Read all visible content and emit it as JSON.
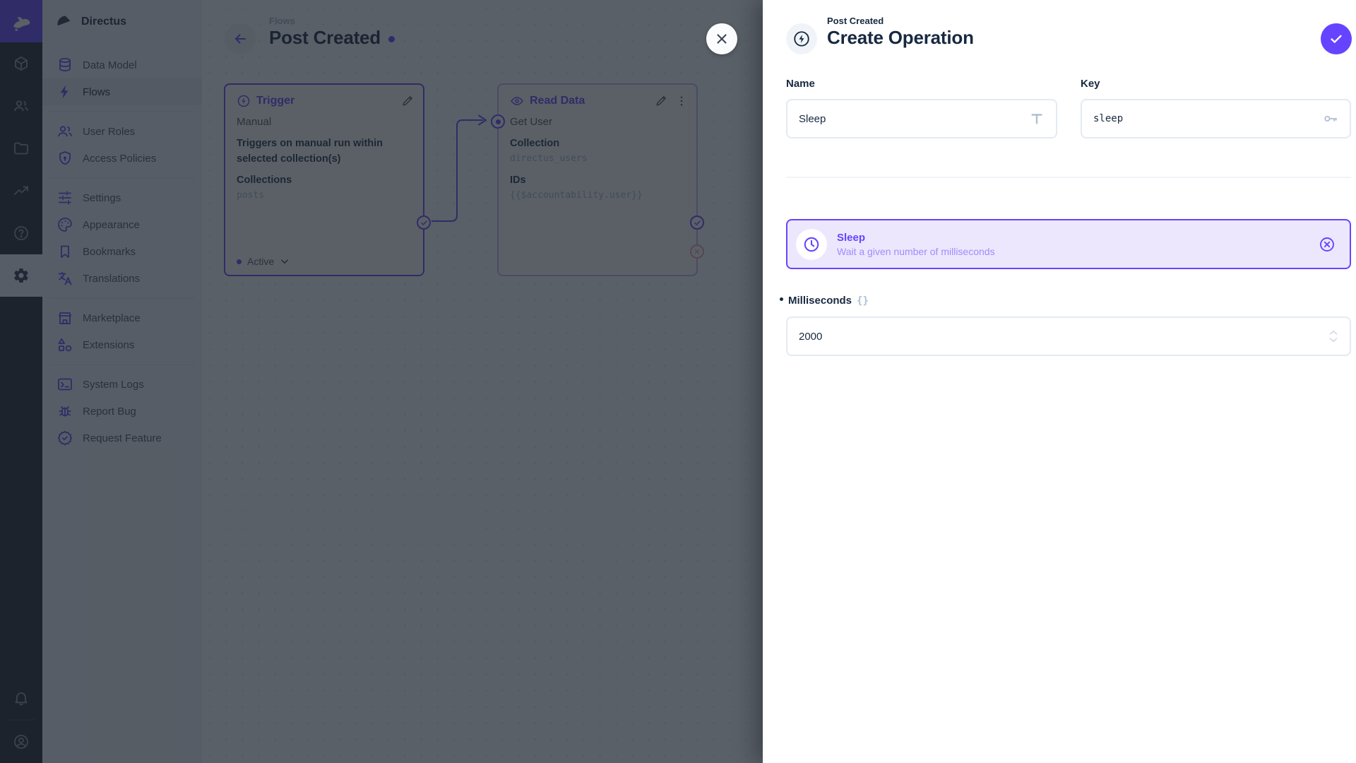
{
  "app": {
    "project_name": "Directus"
  },
  "colors": {
    "accent": "#6644ff",
    "error": "#e35169",
    "navy": "#172940"
  },
  "module_bar": {
    "modules": [
      {
        "name": "content"
      },
      {
        "name": "users"
      },
      {
        "name": "files"
      },
      {
        "name": "insights"
      },
      {
        "name": "docs"
      },
      {
        "name": "settings",
        "active": true
      }
    ],
    "bottom": [
      {
        "name": "notifications"
      },
      {
        "name": "account"
      }
    ]
  },
  "sidebar": {
    "groups": [
      {
        "items": [
          {
            "label": "Data Model"
          },
          {
            "label": "Flows",
            "active": true
          }
        ]
      },
      {
        "items": [
          {
            "label": "User Roles"
          },
          {
            "label": "Access Policies"
          }
        ]
      },
      {
        "items": [
          {
            "label": "Settings"
          },
          {
            "label": "Appearance"
          },
          {
            "label": "Bookmarks"
          },
          {
            "label": "Translations"
          }
        ]
      },
      {
        "items": [
          {
            "label": "Marketplace"
          },
          {
            "label": "Extensions"
          }
        ]
      },
      {
        "items": [
          {
            "label": "System Logs"
          },
          {
            "label": "Report Bug"
          },
          {
            "label": "Request Feature"
          }
        ]
      }
    ]
  },
  "flow": {
    "breadcrumb": "Flows",
    "title": "Post Created",
    "trigger_panel": {
      "header": "Trigger",
      "type": "Manual",
      "description": "Triggers on manual run within selected collection(s)",
      "collections_label": "Collections",
      "collections_value": "posts",
      "status": "Active"
    },
    "read_data_panel": {
      "header": "Read Data",
      "name": "Get User",
      "collection_label": "Collection",
      "collection_value": "directus_users",
      "ids_label": "IDs",
      "ids_value": "{{$accountability.user}}"
    }
  },
  "drawer": {
    "breadcrumb": "Post Created",
    "title": "Create Operation",
    "name_field": {
      "label": "Name",
      "value": "Sleep"
    },
    "key_field": {
      "label": "Key",
      "value": "sleep"
    },
    "operation": {
      "name": "Sleep",
      "description": "Wait a given number of milliseconds"
    },
    "milliseconds_field": {
      "label": "Milliseconds",
      "value": "2000",
      "raw_toggle": "{}"
    }
  }
}
